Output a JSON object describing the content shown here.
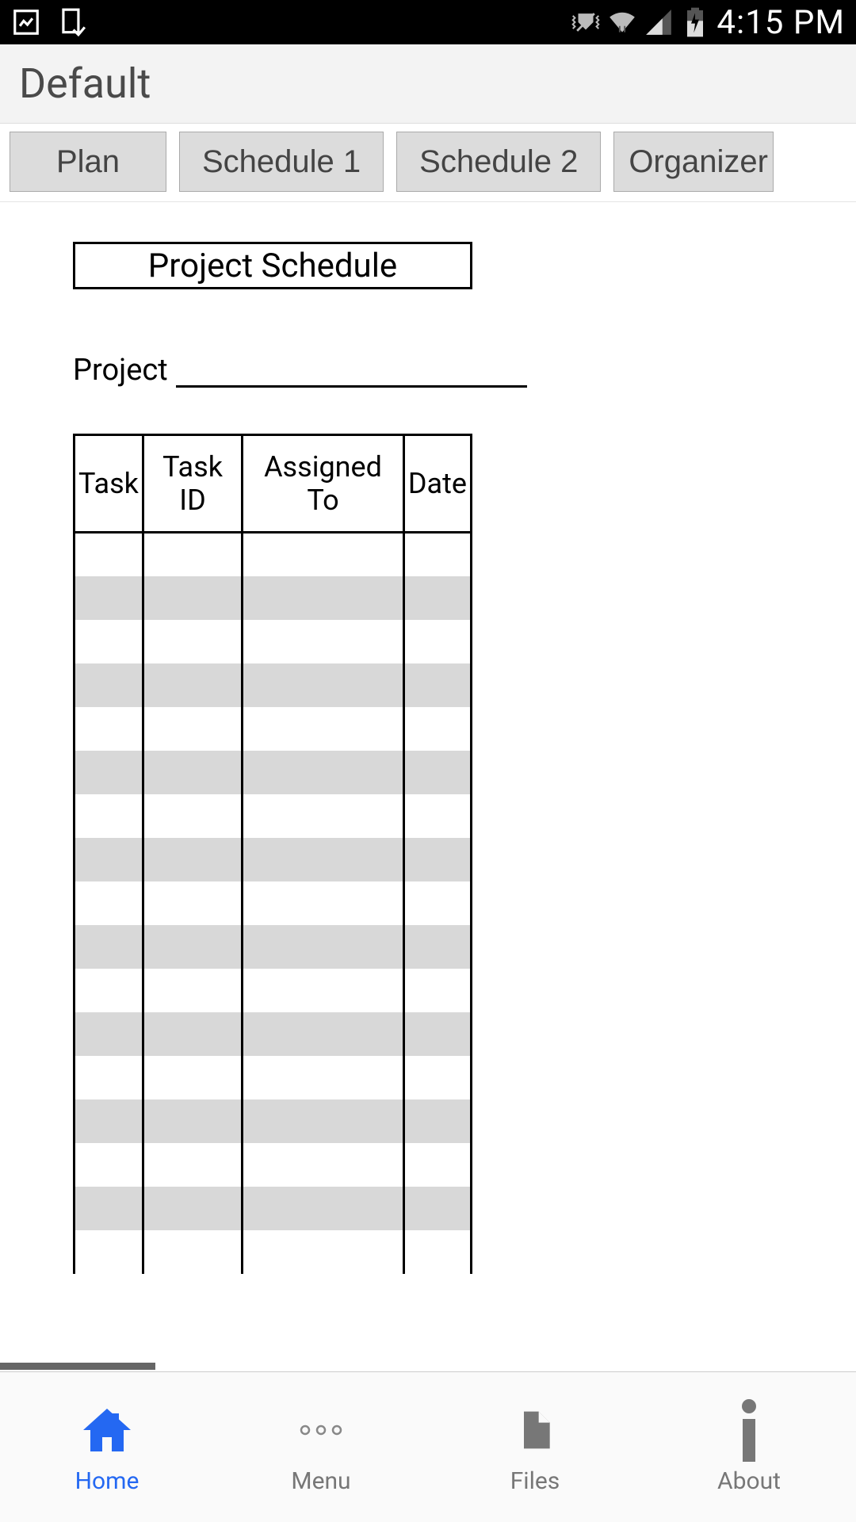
{
  "status": {
    "time": "4:15 PM"
  },
  "header": {
    "title": "Default"
  },
  "tabs": [
    "Plan",
    "Schedule 1",
    "Schedule 2",
    "Organizer"
  ],
  "document": {
    "title": "Project Schedule",
    "project_label": "Project",
    "project_value": "",
    "columns": [
      "Task",
      "Task ID",
      "Assigned To",
      "Date"
    ]
  },
  "nav": {
    "home": "Home",
    "menu": "Menu",
    "files": "Files",
    "about": "About"
  }
}
